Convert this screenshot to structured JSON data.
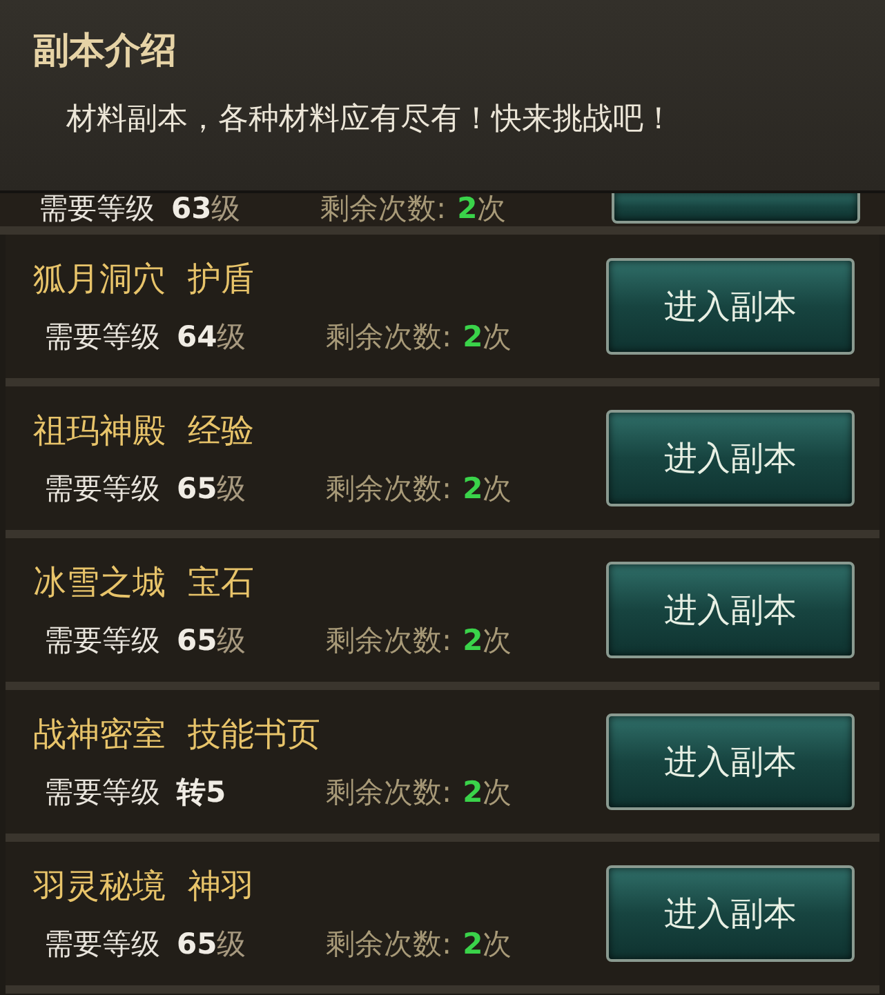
{
  "intro": {
    "title": "副本介绍",
    "text": "材料副本，各种材料应有尽有！快来挑战吧！"
  },
  "partial_row": {
    "level_label": "需要等级",
    "level_value": "63",
    "level_unit": "级",
    "remaining_label": "剩余次数:",
    "remaining_count": "2",
    "remaining_unit": "次"
  },
  "dungeons": [
    {
      "name": "狐月洞穴",
      "reward": "护盾",
      "level_label": "需要等级",
      "level_value": "64",
      "level_unit": "级",
      "remaining_label": "剩余次数:",
      "remaining_count": "2",
      "remaining_unit": "次",
      "button": "进入副本"
    },
    {
      "name": "祖玛神殿",
      "reward": "经验",
      "level_label": "需要等级",
      "level_value": "65",
      "level_unit": "级",
      "remaining_label": "剩余次数:",
      "remaining_count": "2",
      "remaining_unit": "次",
      "button": "进入副本"
    },
    {
      "name": "冰雪之城",
      "reward": "宝石",
      "level_label": "需要等级",
      "level_value": "65",
      "level_unit": "级",
      "remaining_label": "剩余次数:",
      "remaining_count": "2",
      "remaining_unit": "次",
      "button": "进入副本"
    },
    {
      "name": "战神密室",
      "reward": "技能书页",
      "level_label": "需要等级",
      "level_value": "转5",
      "remaining_label": "剩余次数:",
      "remaining_count": "2",
      "remaining_unit": "次",
      "button": "进入副本"
    },
    {
      "name": "羽灵秘境",
      "reward": "神羽",
      "level_label": "需要等级",
      "level_value": "65",
      "level_unit": "级",
      "remaining_label": "剩余次数:",
      "remaining_count": "2",
      "remaining_unit": "次",
      "button": "进入副本"
    }
  ]
}
